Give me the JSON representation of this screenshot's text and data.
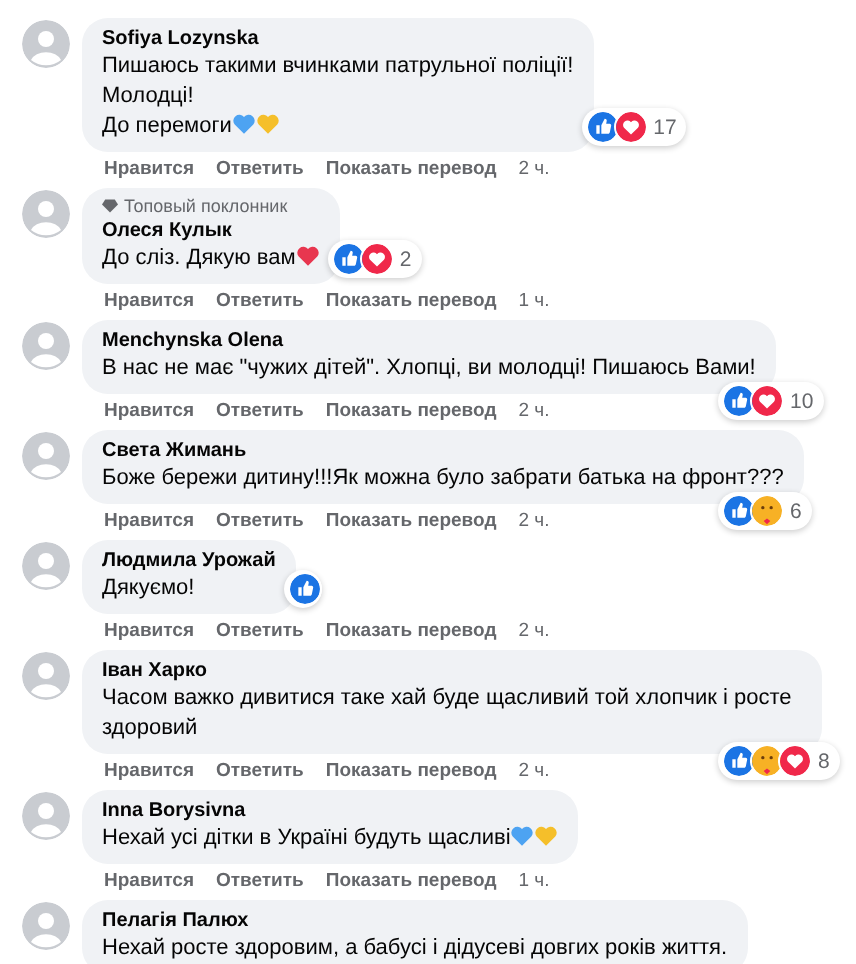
{
  "comments": [
    {
      "author": "Sofiya Lozynska",
      "lines": [
        "Пишаюсь такими вчинками патрульної поліції!",
        "Молодці!",
        "До перемоги"
      ],
      "emoji": [
        {
          "color": "#4da3f2"
        },
        {
          "color": "#f5bf2a"
        }
      ],
      "reactions": [
        {
          "kind": "like"
        },
        {
          "kind": "love"
        }
      ],
      "count": "17",
      "actions": [
        "Нравится",
        "Ответить",
        "Показать перевод"
      ],
      "time": "2 ч."
    },
    {
      "author": "Олеся Кулык",
      "badge": "Топовый поклонник",
      "lines": [
        "До сліз. Дякую вам"
      ],
      "emoji": [
        {
          "color": "#e8364f"
        }
      ],
      "reactions": [
        {
          "kind": "like"
        },
        {
          "kind": "love"
        }
      ],
      "count": "2",
      "actions": [
        "Нравится",
        "Ответить",
        "Показать перевод"
      ],
      "time": "1 ч."
    },
    {
      "author": "Menchynska Olena",
      "lines": [
        "В нас не має \"чужих дітей\". Хлопці, ви молодці! Пишаюсь Вами!"
      ],
      "reactions": [
        {
          "kind": "like"
        },
        {
          "kind": "love"
        }
      ],
      "count": "10",
      "actions": [
        "Нравится",
        "Ответить",
        "Показать перевод"
      ],
      "time": "2 ч."
    },
    {
      "author": "Света Жимань",
      "lines": [
        "Боже бережи дитину!!!Як можна було забрати батька на фронт???"
      ],
      "reactions": [
        {
          "kind": "like"
        },
        {
          "kind": "care"
        }
      ],
      "count": "6",
      "actions": [
        "Нравится",
        "Ответить",
        "Показать перевод"
      ],
      "time": "2 ч."
    },
    {
      "author": "Людмила Урожай",
      "lines": [
        "Дякуємо!"
      ],
      "reactions": [
        {
          "kind": "like"
        }
      ],
      "actions": [
        "Нравится",
        "Ответить",
        "Показать перевод"
      ],
      "time": "2 ч."
    },
    {
      "author": "Іван Харко",
      "lines": [
        "Часом важко дивитися таке хай буде щасливий той хлопчик і росте здоровий"
      ],
      "reactions": [
        {
          "kind": "like"
        },
        {
          "kind": "care"
        },
        {
          "kind": "love"
        }
      ],
      "count": "8",
      "actions": [
        "Нравится",
        "Ответить",
        "Показать перевод"
      ],
      "time": "2 ч."
    },
    {
      "author": "Inna Borysivna",
      "lines": [
        "Нехай усі дітки в Україні будуть щасливі"
      ],
      "emoji": [
        {
          "color": "#4da3f2"
        },
        {
          "color": "#f5bf2a"
        }
      ],
      "actions": [
        "Нравится",
        "Ответить",
        "Показать перевод"
      ],
      "time": "1 ч."
    },
    {
      "author": "Пелагія Палюх",
      "lines": [
        "Нехай росте здоровим, а бабусі і дідусеві довгих років життя."
      ]
    }
  ]
}
